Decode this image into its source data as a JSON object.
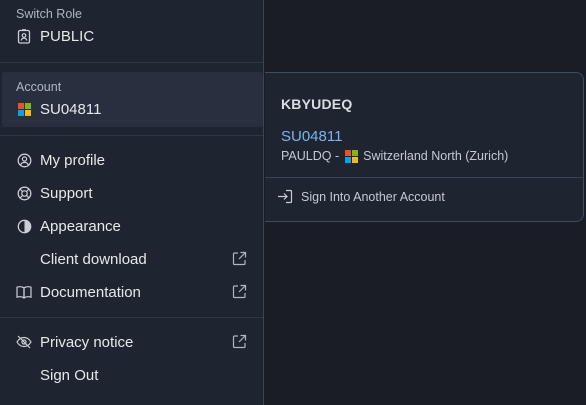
{
  "switch_role": {
    "label": "Switch Role",
    "value": "PUBLIC",
    "icon": "badge-icon"
  },
  "account": {
    "label": "Account",
    "value": "SU04811",
    "icon": "microsoft-logo-icon"
  },
  "menu_items": [
    {
      "label": "My profile",
      "icon": "user-circle-icon",
      "external": false
    },
    {
      "label": "Support",
      "icon": "lifebuoy-icon",
      "external": false
    },
    {
      "label": "Appearance",
      "icon": "half-circle-icon",
      "external": false
    },
    {
      "label": "Client download",
      "icon": "",
      "external": true
    },
    {
      "label": "Documentation",
      "icon": "book-icon",
      "external": true
    },
    {
      "label": "Privacy notice",
      "icon": "eye-slash-icon",
      "external": true
    },
    {
      "label": "Sign Out",
      "icon": "",
      "external": false
    }
  ],
  "account_popover": {
    "org_name": "KBYUDEQ",
    "account_id": "SU04811",
    "user": "PAULDQ -",
    "region": "Switzerland North (Zurich)",
    "sign_in_other": "Sign Into Another Account"
  },
  "colors": {
    "background": "#1a1e24",
    "menu_background": "#1f2530",
    "accent_link": "#79b4ee",
    "ms_red": "#f25022",
    "ms_green": "#7fba00",
    "ms_blue": "#00a4ef",
    "ms_yellow": "#ffb900"
  }
}
